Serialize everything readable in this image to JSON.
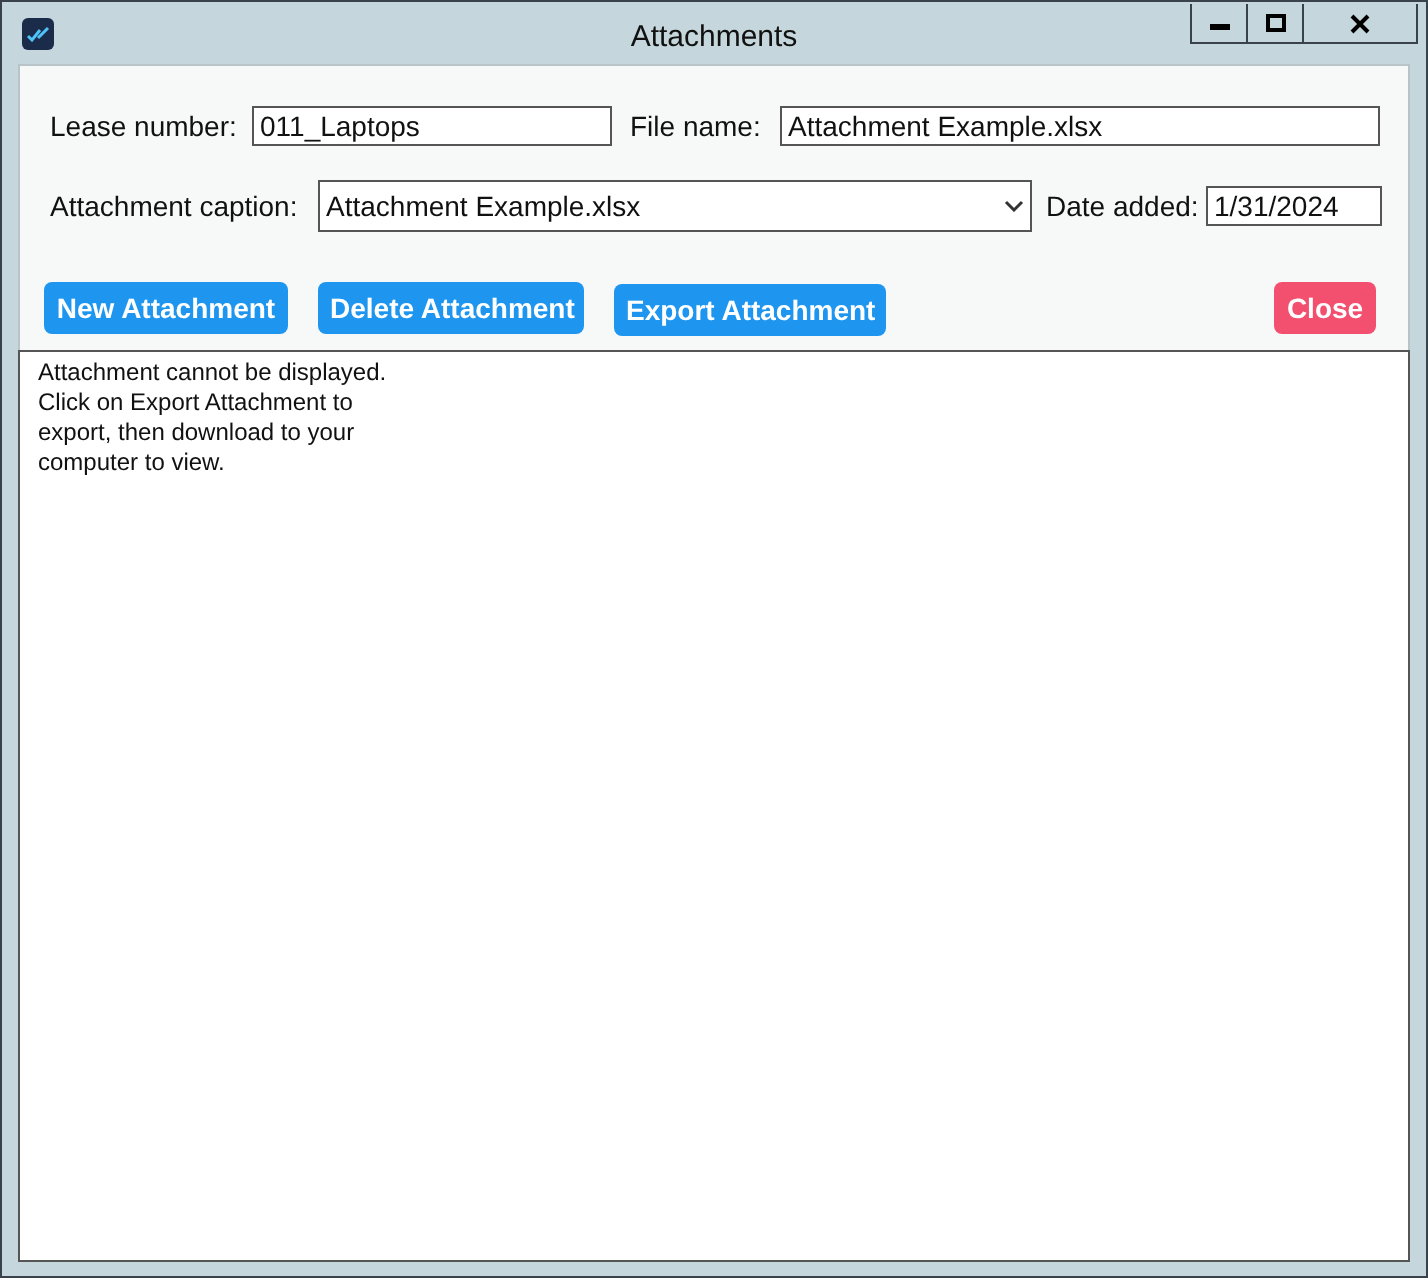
{
  "window": {
    "title": "Attachments"
  },
  "fields": {
    "lease_number": {
      "label": "Lease number:",
      "value": "011_Laptops"
    },
    "file_name": {
      "label": "File name:",
      "value": "Attachment Example.xlsx"
    },
    "attachment_caption": {
      "label": "Attachment caption:",
      "value": "Attachment Example.xlsx"
    },
    "date_added": {
      "label": "Date added:",
      "value": "1/31/2024"
    }
  },
  "buttons": [
    {
      "label": "New Attachment",
      "kind": "primary"
    },
    {
      "label": "Delete Attachment",
      "kind": "primary"
    },
    {
      "label": "Export Attachment",
      "kind": "primary"
    },
    {
      "label": "Close",
      "kind": "danger"
    }
  ],
  "message": [
    "Attachment cannot be displayed.",
    "Click on Export Attachment to",
    "export, then download to your",
    "computer to view."
  ]
}
